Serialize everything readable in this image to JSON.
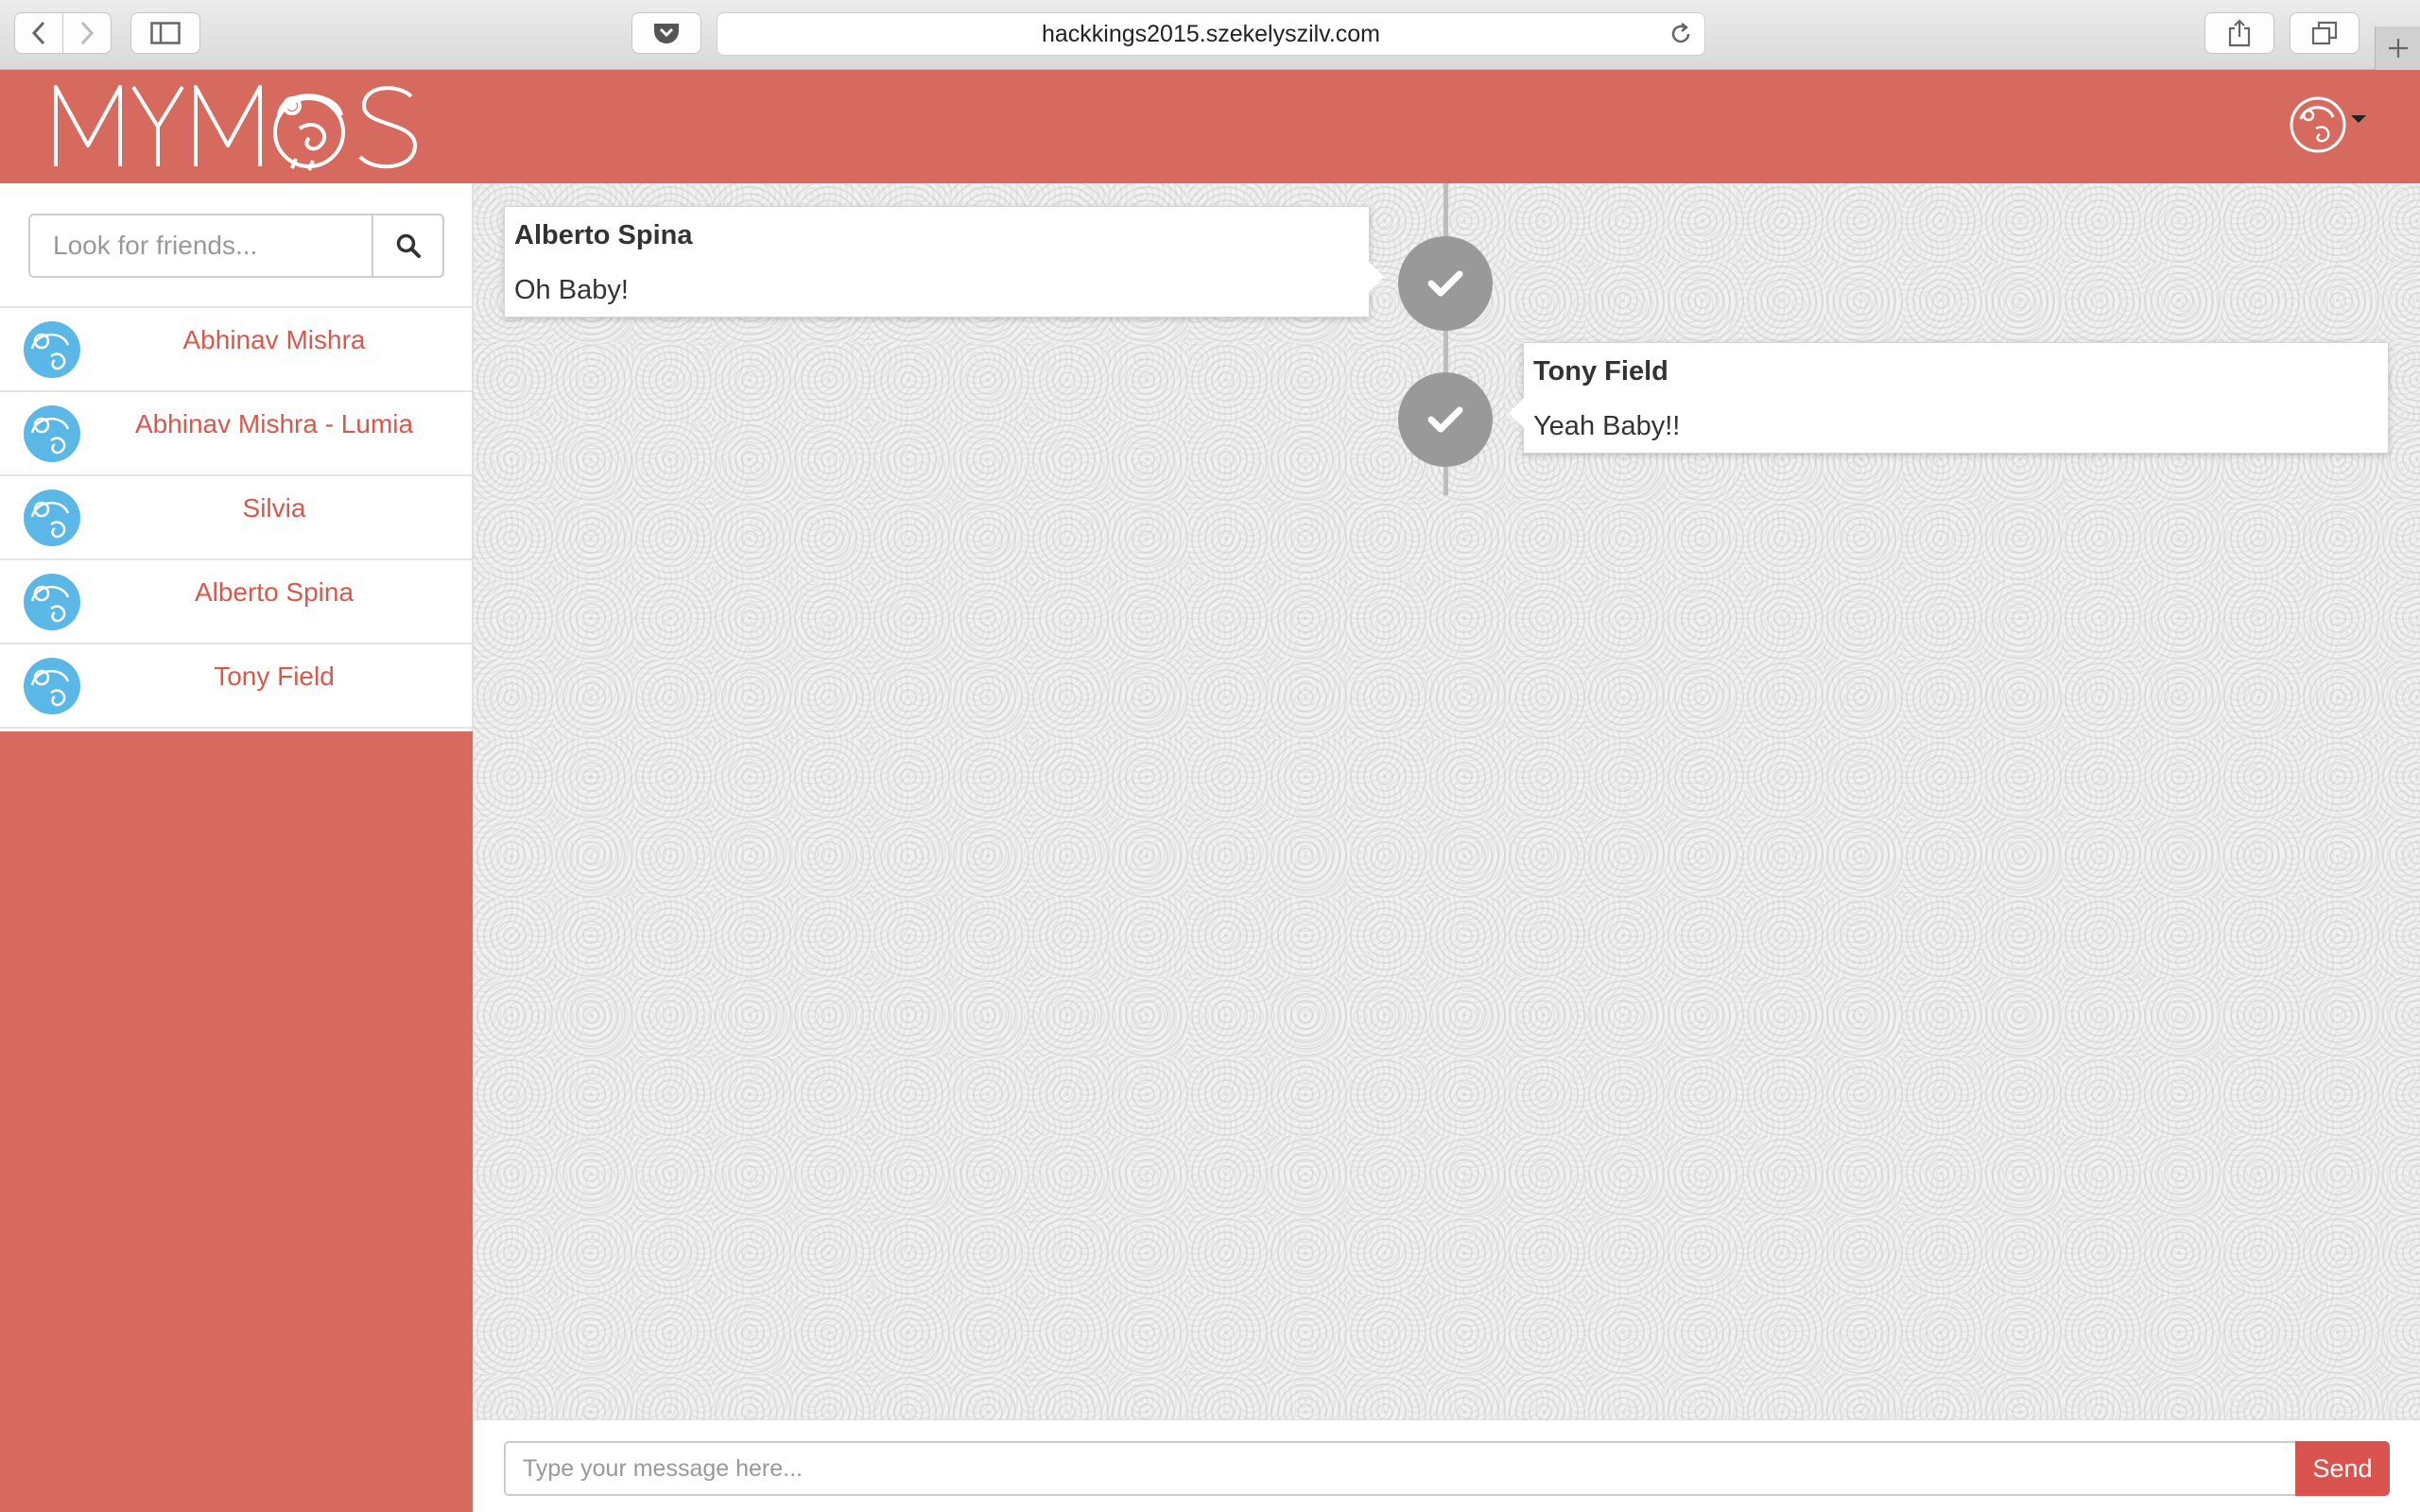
{
  "browser": {
    "url": "hackkings2015.szekelyszilv.com",
    "icons": [
      "back-icon",
      "forward-icon",
      "sidebar-icon",
      "pocket-icon",
      "reload-icon",
      "share-icon",
      "tabs-icon",
      "new-tab-icon"
    ]
  },
  "header": {
    "logo_text": "MYMOS",
    "brand_color": "#d76a5e"
  },
  "sidebar": {
    "search_placeholder": "Look for friends...",
    "friends": [
      {
        "name": "Abhinav Mishra"
      },
      {
        "name": "Abhinav Mishra - Lumia"
      },
      {
        "name": "Silvia"
      },
      {
        "name": "Alberto Spina"
      },
      {
        "name": "Tony Field"
      }
    ]
  },
  "messages": [
    {
      "author": "Alberto Spina",
      "text": "Oh Baby!",
      "side": "left",
      "status_icon": "check-icon"
    },
    {
      "author": "Tony Field",
      "text": "Yeah Baby!!",
      "side": "right",
      "status_icon": "check-icon"
    }
  ],
  "composer": {
    "placeholder": "Type your message here...",
    "send_label": "Send",
    "send_color": "#d9534f"
  }
}
